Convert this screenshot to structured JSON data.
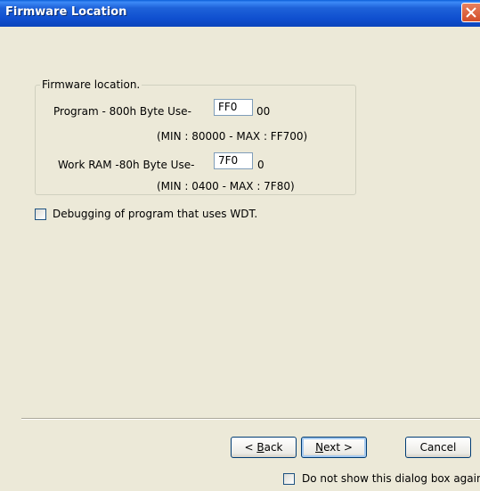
{
  "window": {
    "title": "Firmware Location",
    "close_icon": "close-icon",
    "colors": {
      "titlebar": "#0f4fcf",
      "close": "#d24e2a",
      "face": "#ece9d8"
    }
  },
  "group": {
    "legend": "Firmware location.",
    "program": {
      "label": "Program - 800h Byte Use-",
      "value": "FF0",
      "suffix": "00",
      "range": "(MIN : 80000  -  MAX : FF700)"
    },
    "work_ram": {
      "label": "Work RAM -80h Byte Use-",
      "value": "7F0",
      "suffix": "0",
      "range": "(MIN : 0400  -  MAX : 7F80)"
    }
  },
  "debug_checkbox": {
    "label": "Debugging of program that uses WDT.",
    "checked": false
  },
  "buttons": {
    "back": {
      "prefix": "< ",
      "mnemonic": "B",
      "rest": "ack"
    },
    "next": {
      "mnemonic": "N",
      "rest": "ext >"
    },
    "cancel": "Cancel"
  },
  "dont_show_checkbox": {
    "label": "Do not show this dialog box again.",
    "checked": false
  }
}
